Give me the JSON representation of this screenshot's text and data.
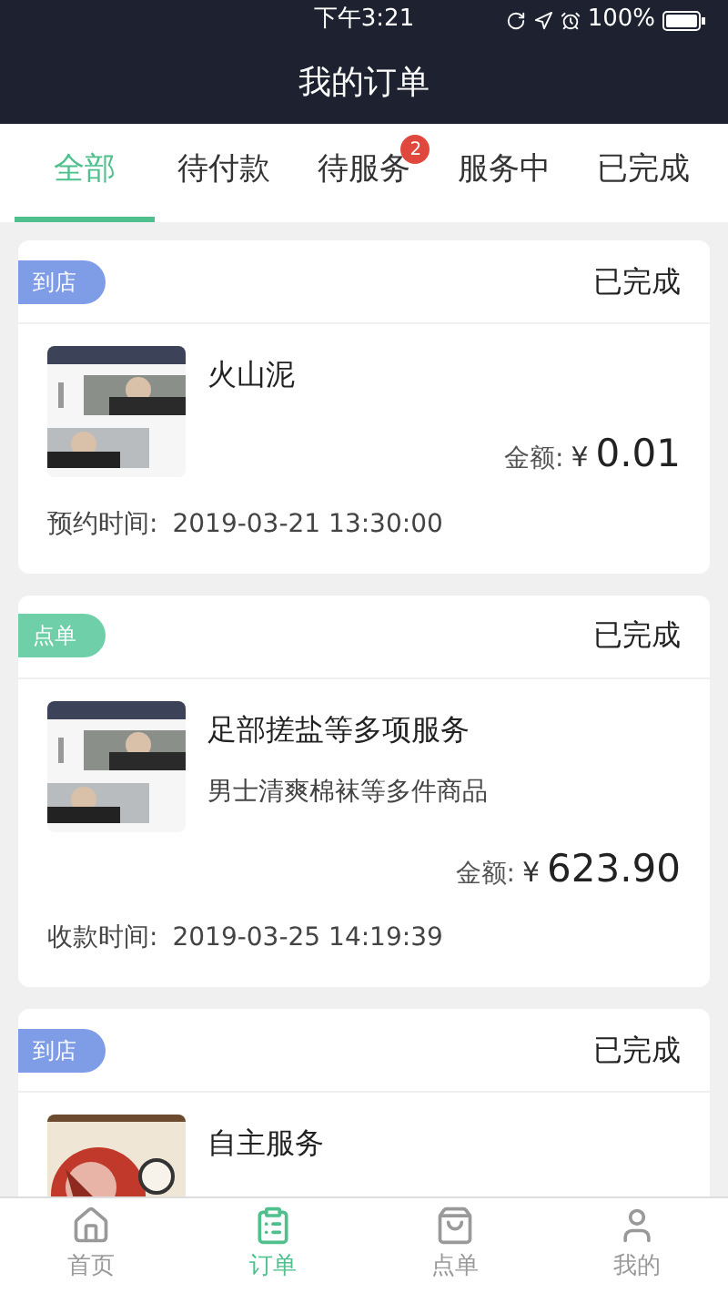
{
  "status_bar": {
    "time": "下午3:21",
    "battery": "100%"
  },
  "header": {
    "title": "我的订单"
  },
  "tabs": [
    {
      "label": "全部",
      "selected": true
    },
    {
      "label": "待付款",
      "selected": false
    },
    {
      "label": "待服务",
      "selected": false,
      "badge": "2"
    },
    {
      "label": "服务中",
      "selected": false
    },
    {
      "label": "已完成",
      "selected": false
    }
  ],
  "orders": [
    {
      "tag": "到店",
      "color": "#7f9de6",
      "status": "已完成",
      "title": "火山泥",
      "amount_label": "金额:",
      "currency": "¥",
      "amount": "0.01",
      "time_label": "预约时间:",
      "time": "2019-03-21 13:30:00"
    },
    {
      "tag": "点单",
      "color": "#6fcfa9",
      "status": "已完成",
      "title": "足部搓盐等多项服务",
      "subtitle": "男士清爽棉袜等多件商品",
      "amount_label": "金额:",
      "currency": "¥",
      "amount": "623.90",
      "time_label": "收款时间:",
      "time": "2019-03-25 14:19:39"
    },
    {
      "tag": "到店",
      "color": "#7f9de6",
      "status": "已完成",
      "title": "自主服务"
    }
  ],
  "bottom_nav": [
    {
      "label": "首页",
      "selected": false
    },
    {
      "label": "订单",
      "selected": true
    },
    {
      "label": "点单",
      "selected": false
    },
    {
      "label": "我的",
      "selected": false
    }
  ]
}
